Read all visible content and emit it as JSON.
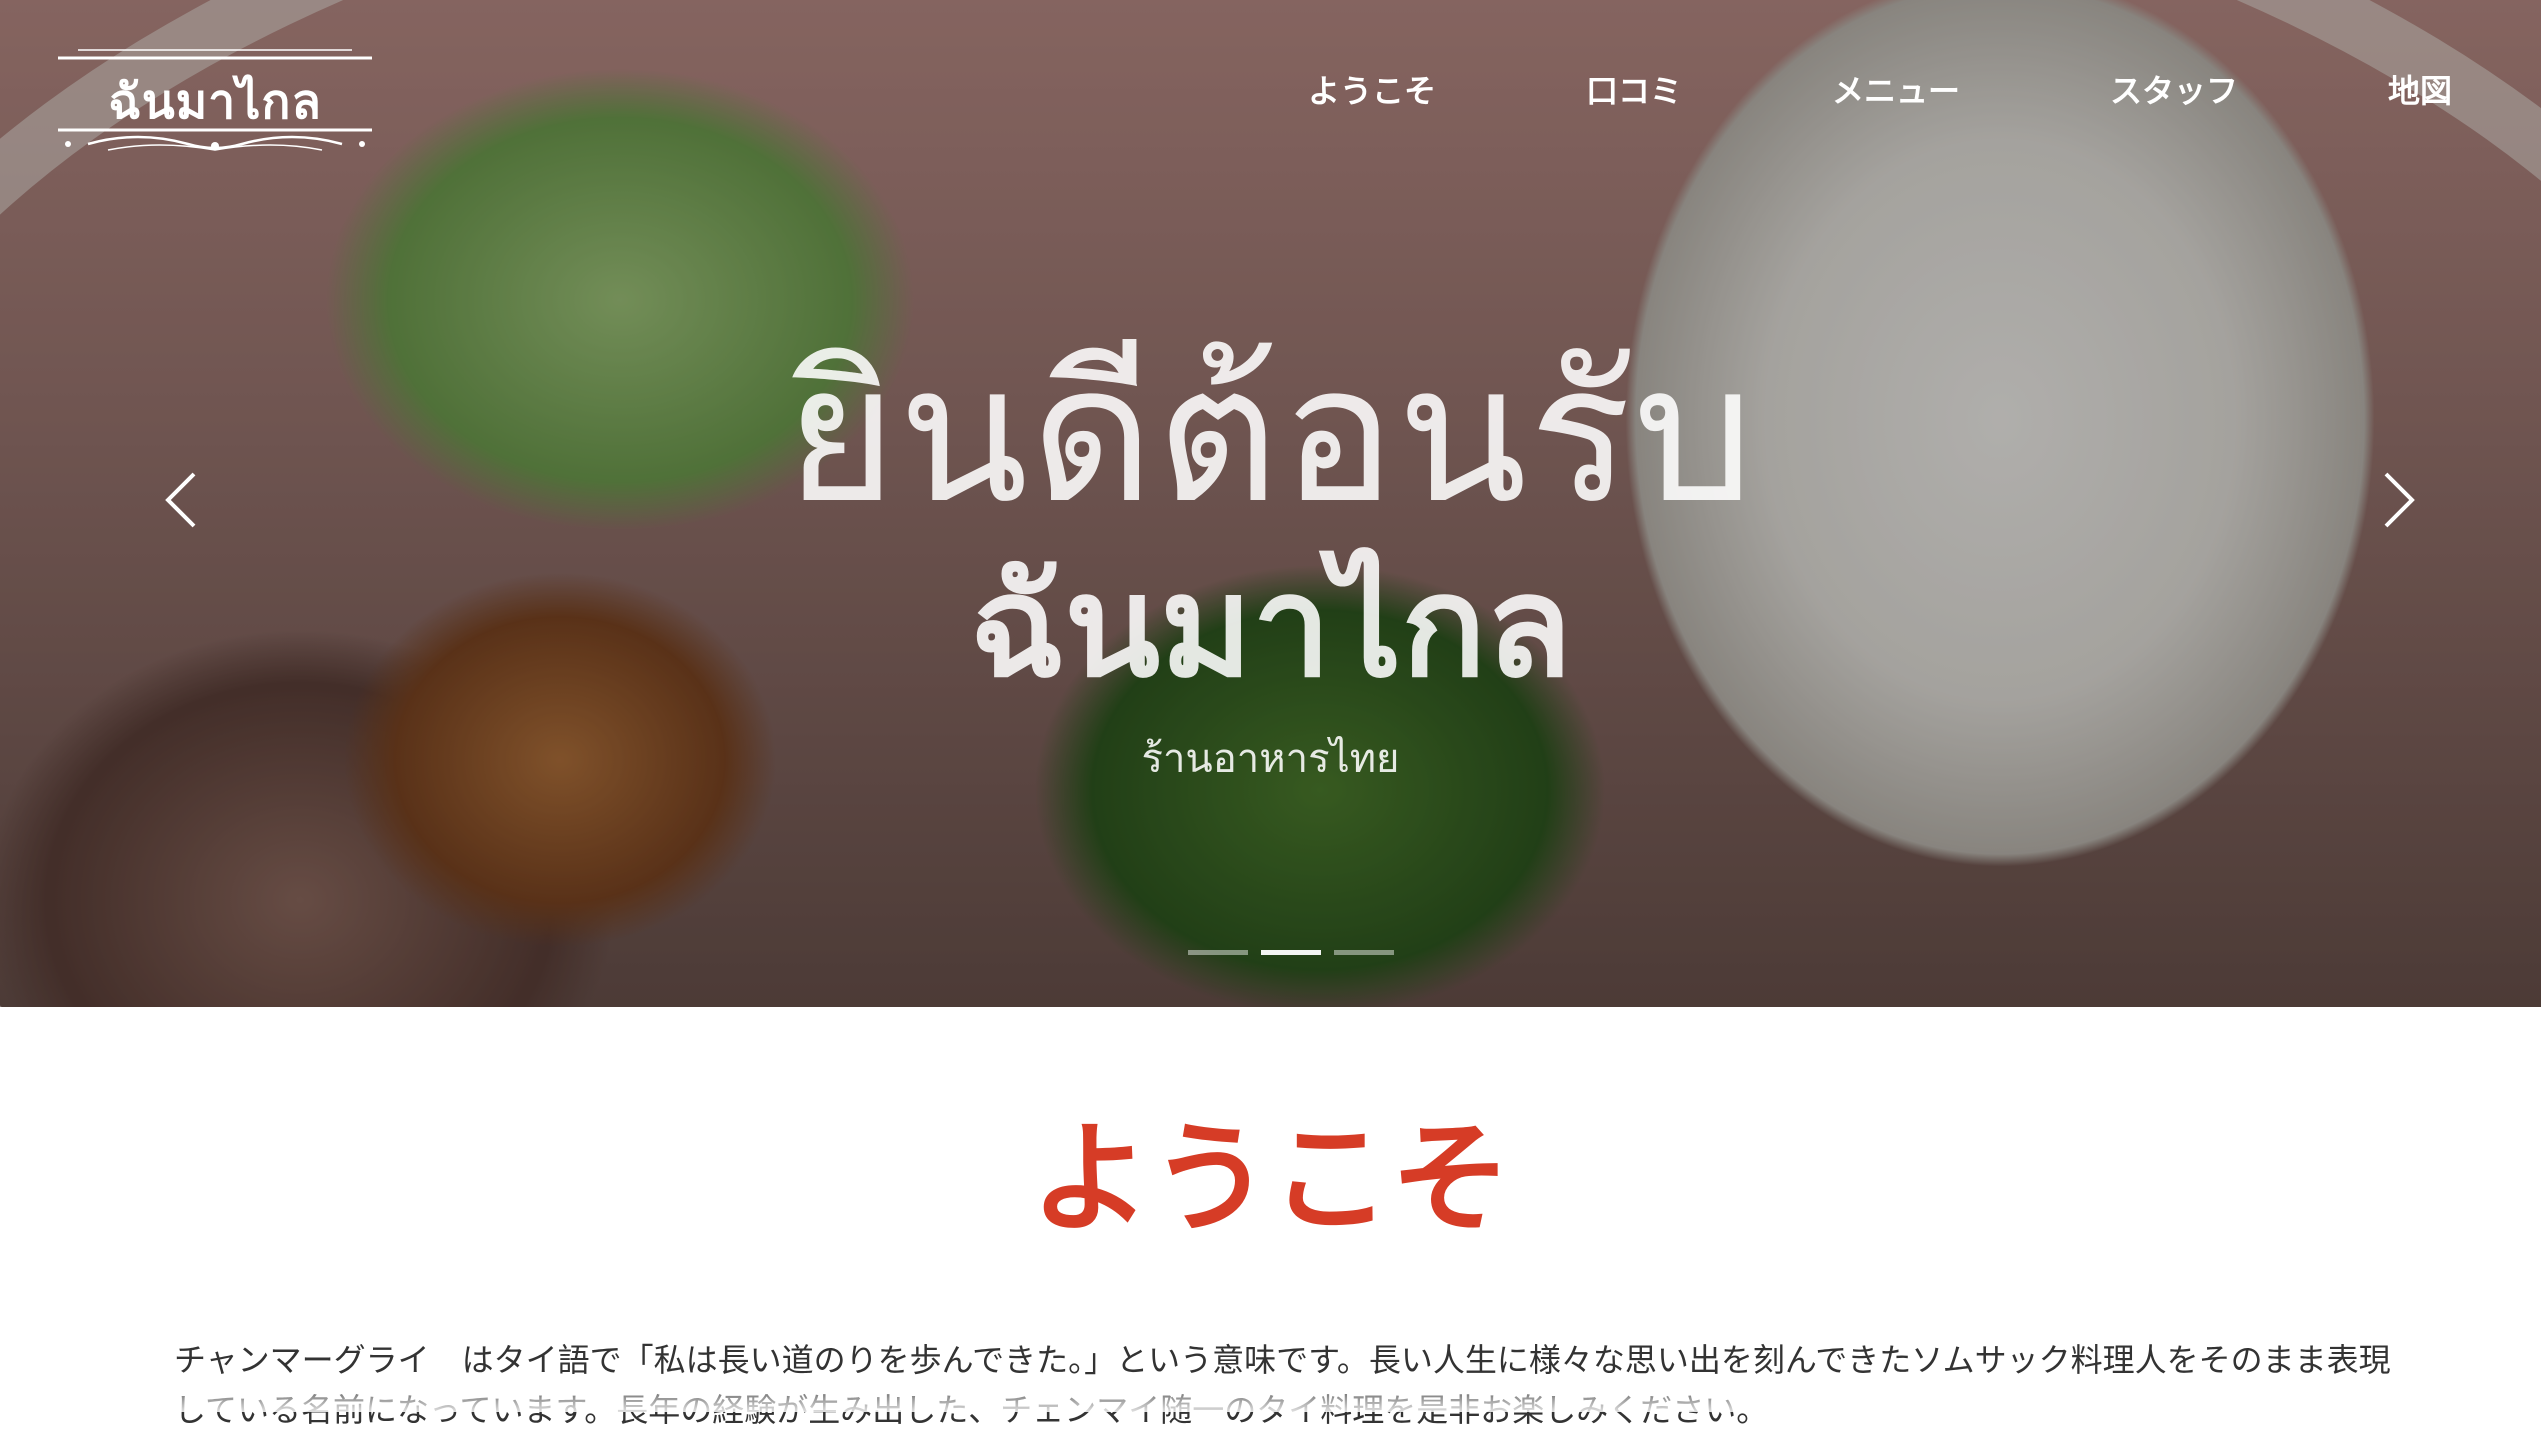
{
  "brand": {
    "logo_text": "ฉันมาไกล"
  },
  "nav": {
    "items": [
      {
        "label": "ようこそ"
      },
      {
        "label": "口コミ"
      },
      {
        "label": "メニュー"
      },
      {
        "label": "スタッフ"
      },
      {
        "label": "地図"
      }
    ]
  },
  "hero": {
    "title": "ยินดีต้อนรับ",
    "subtitle": "ฉันมาไกล",
    "tagline": "ร้านอาหารไทย",
    "prev_icon": "chevron-left-icon",
    "next_icon": "chevron-right-icon",
    "slide_count": 3,
    "active_slide": 2
  },
  "welcome": {
    "heading": "ようこそ",
    "body": "チャンマーグライ　はタイ語で「私は長い道のりを歩んできた。」という意味です。長い人生に様々な思い出を刻んできたソムサック料理人をそのまま表現している名前になっています。長年の経験が生み出した、チェンマイ随一のタイ料理を是非お楽しみください。"
  },
  "colors": {
    "accent": "#d63c26",
    "text": "#333333",
    "nav_text": "#ffffff"
  }
}
